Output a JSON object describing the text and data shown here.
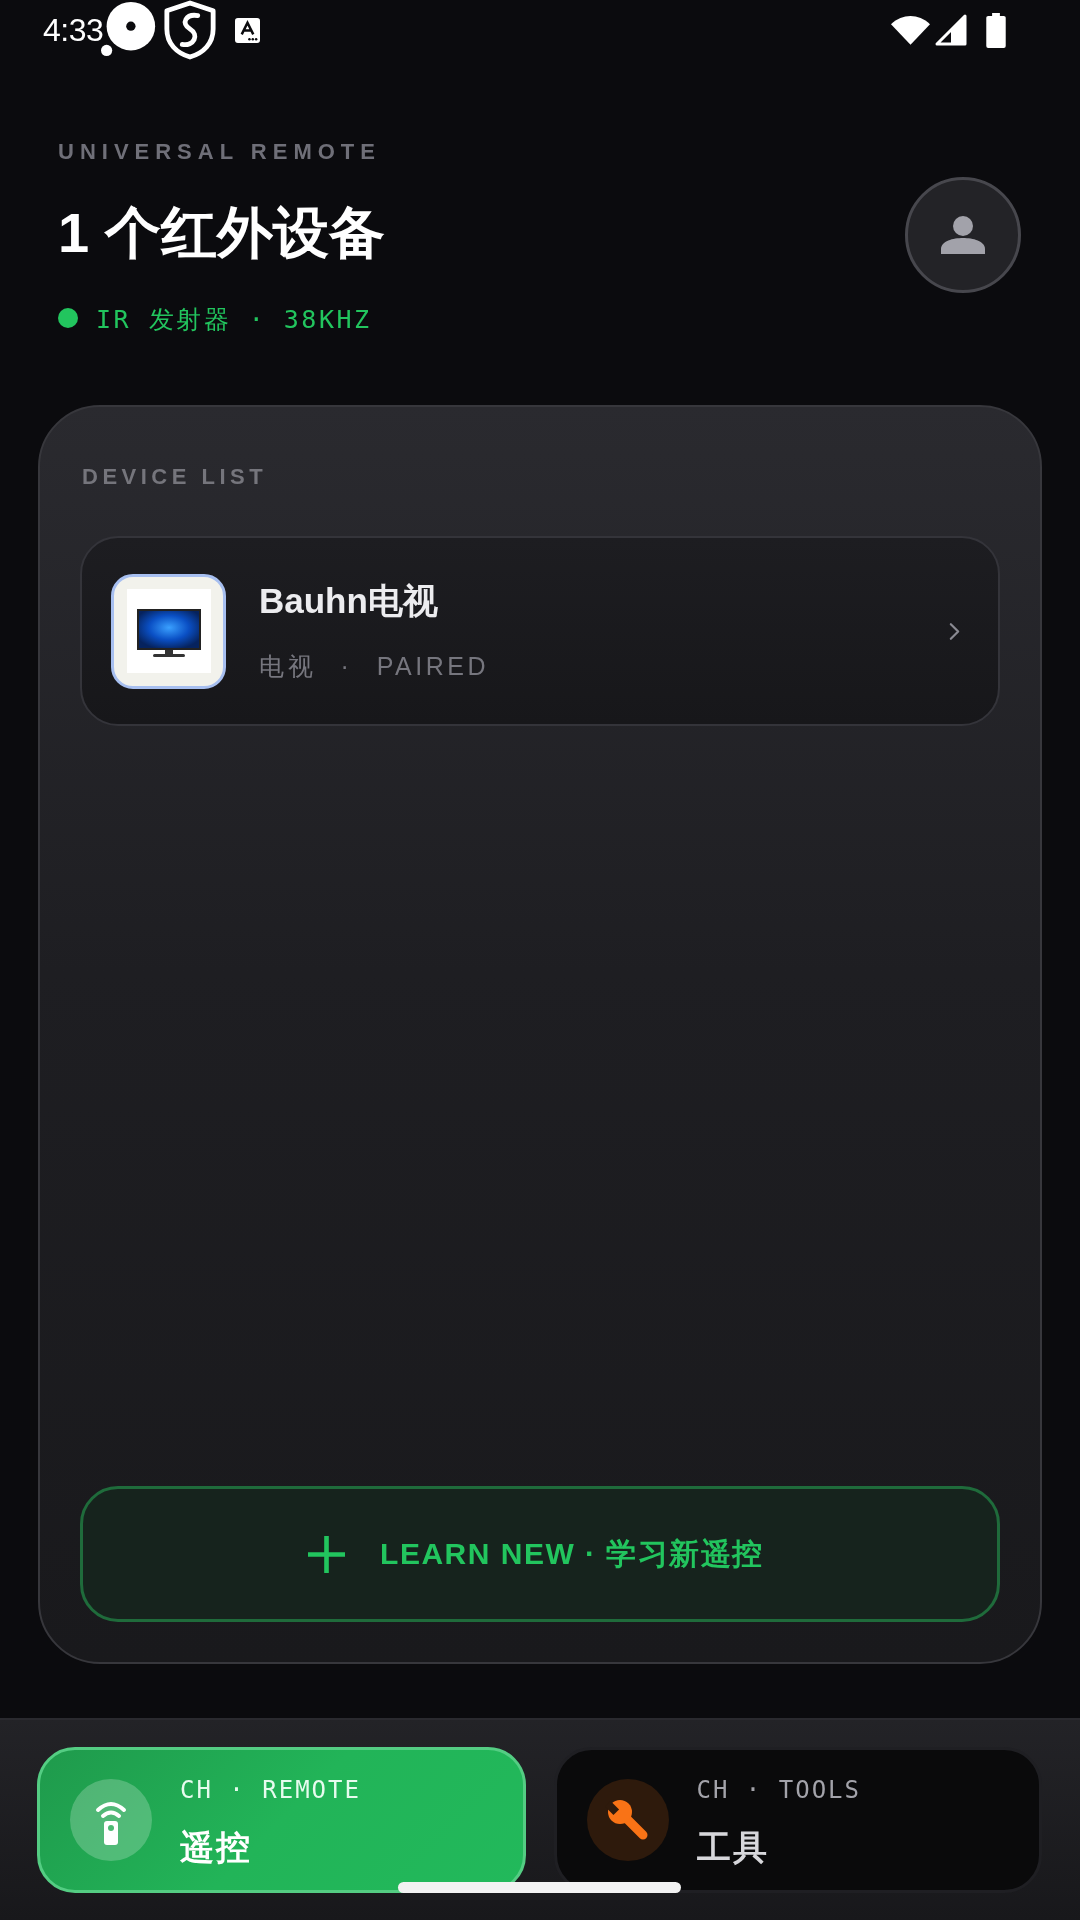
{
  "status_bar": {
    "time": "4:33"
  },
  "header": {
    "eyebrow": "UNIVERSAL REMOTE",
    "title": "1 个红外设备",
    "status": {
      "text": "IR 发射器 · 38KHZ",
      "active": true
    }
  },
  "device_list": {
    "title": "DEVICE LIST",
    "devices": [
      {
        "name": "Bauhn电视",
        "subtitle": "电视 · PAIRED"
      }
    ]
  },
  "learn_button": {
    "label": "LEARN NEW · 学习新遥控"
  },
  "bottom_nav": {
    "tabs": [
      {
        "kind": "remote",
        "channel": "CH · REMOTE",
        "label": "遥控",
        "selected": true
      },
      {
        "kind": "tools",
        "channel": "CH · TOOLS",
        "label": "工具",
        "selected": false
      }
    ]
  }
}
